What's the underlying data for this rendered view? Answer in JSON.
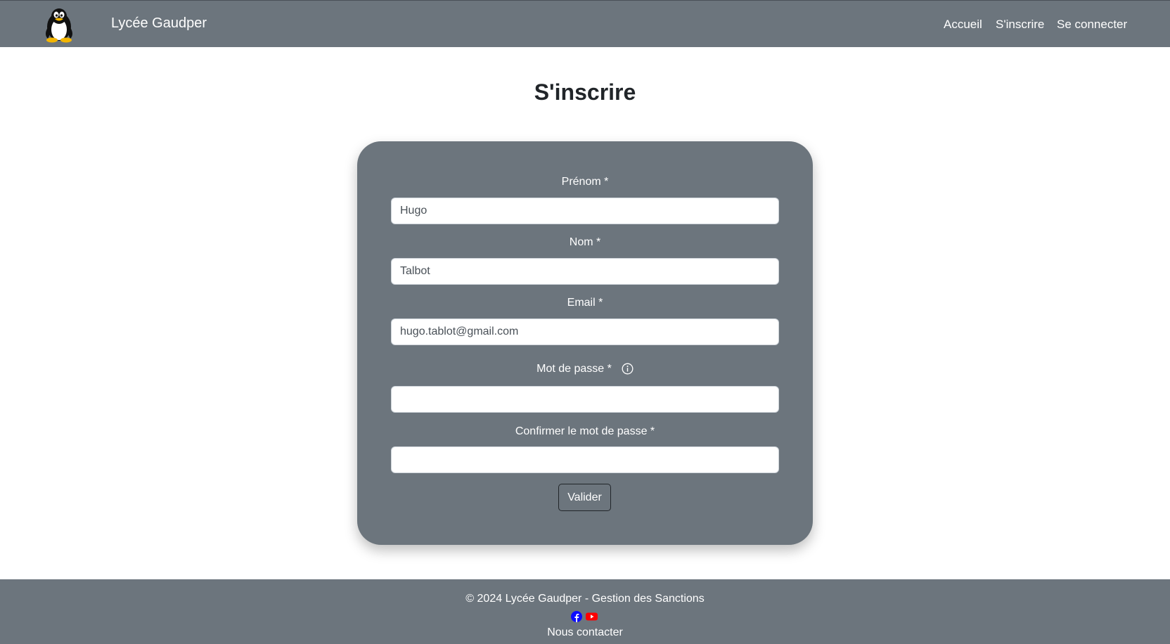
{
  "navbar": {
    "brand_name": "Lycée Gaudper",
    "logo_icon": "tux-penguin-icon",
    "links": {
      "home": "Accueil",
      "register": "S'inscrire",
      "login": "Se connecter"
    }
  },
  "page": {
    "title": "S'inscrire"
  },
  "form": {
    "first_name": {
      "label": "Prénom *",
      "value": "Hugo"
    },
    "last_name": {
      "label": "Nom *",
      "value": "Talbot"
    },
    "email": {
      "label": "Email *",
      "value": "hugo.tablot@gmail.com"
    },
    "password": {
      "label": "Mot de passe *",
      "value": ""
    },
    "confirm_password": {
      "label": "Confirmer le mot de passe *",
      "value": ""
    },
    "submit_label": "Valider"
  },
  "footer": {
    "copyright": "© 2024 Lycée Gaudper - Gestion des Sanctions",
    "social_icons": [
      "facebook-icon",
      "youtube-icon"
    ],
    "contact_label": "Nous contacter"
  },
  "colors": {
    "primary_gray": "#6c757d",
    "facebook_blue": "#0d0dff",
    "youtube_red": "#ff0000"
  }
}
